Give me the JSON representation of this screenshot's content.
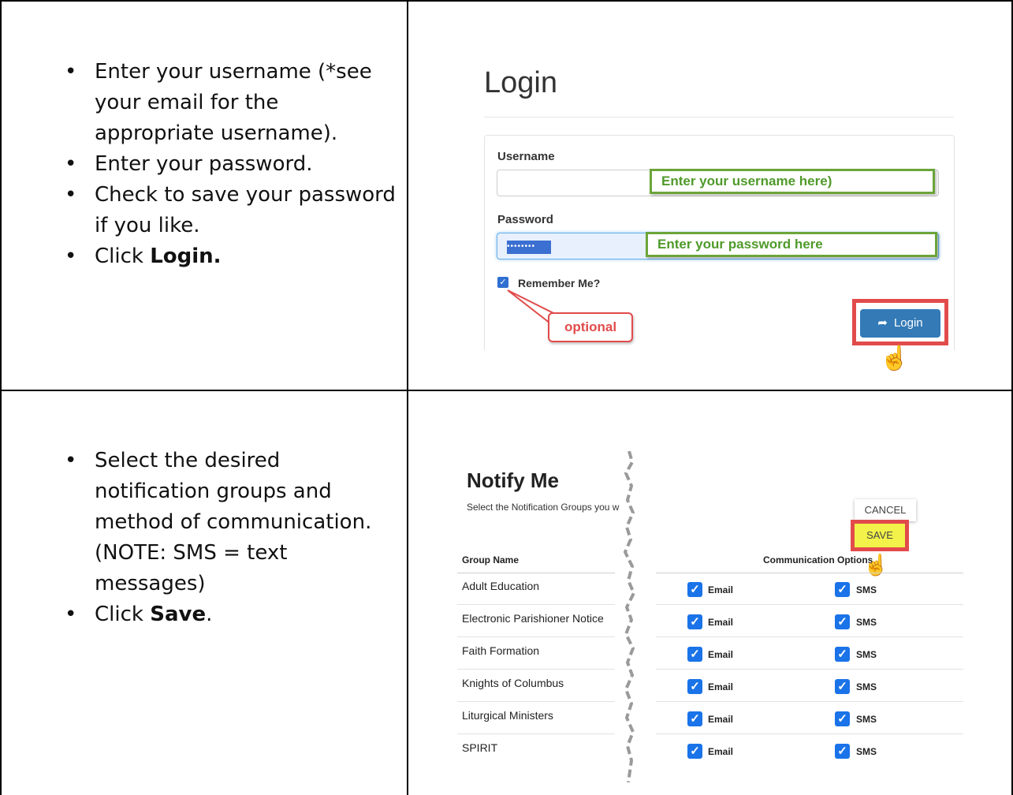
{
  "row1": {
    "instructions": [
      {
        "text": "Enter your username (*see your email for the appropriate username)."
      },
      {
        "text": "Enter your password."
      },
      {
        "text": "Check to save your password if you like."
      },
      {
        "prefix": "Click ",
        "bold": "Login."
      }
    ],
    "login": {
      "title": "Login",
      "username_label": "Username",
      "password_label": "Password",
      "password_value": "••••••••",
      "username_hint": "Enter your username here)",
      "password_hint": "Enter your password here",
      "remember_label": "Remember Me?",
      "optional_callout": "optional",
      "login_button": "Login",
      "login_icon": "share-arrow-icon"
    }
  },
  "row2": {
    "instructions": [
      {
        "text": "Select the desired notification groups and method of communication. (NOTE: SMS = text messages)"
      },
      {
        "prefix": "Click ",
        "bold": "Save",
        "suffix": "."
      }
    ],
    "notify": {
      "title": "Notify Me",
      "subtitle": "Select the Notification Groups you w",
      "cancel_button": "CANCEL",
      "save_button": "SAVE",
      "col_group": "Group Name",
      "col_options": "Communication Options",
      "groups": [
        {
          "name": "Adult Education",
          "email": "Email",
          "sms": "SMS"
        },
        {
          "name": "Electronic Parishioner Notice",
          "email": "Email",
          "sms": "SMS"
        },
        {
          "name": "Faith Formation",
          "email": "Email",
          "sms": "SMS"
        },
        {
          "name": "Knights of Columbus",
          "email": "Email",
          "sms": "SMS"
        },
        {
          "name": "Liturgical Ministers",
          "email": "Email",
          "sms": "SMS"
        },
        {
          "name": "SPIRIT",
          "email": "Email",
          "sms": "SMS"
        }
      ]
    }
  },
  "colors": {
    "accent": "#e24b4b",
    "hint_green": "#6ba539",
    "save_yellow": "#f2f24a",
    "button_blue": "#337ab7"
  }
}
